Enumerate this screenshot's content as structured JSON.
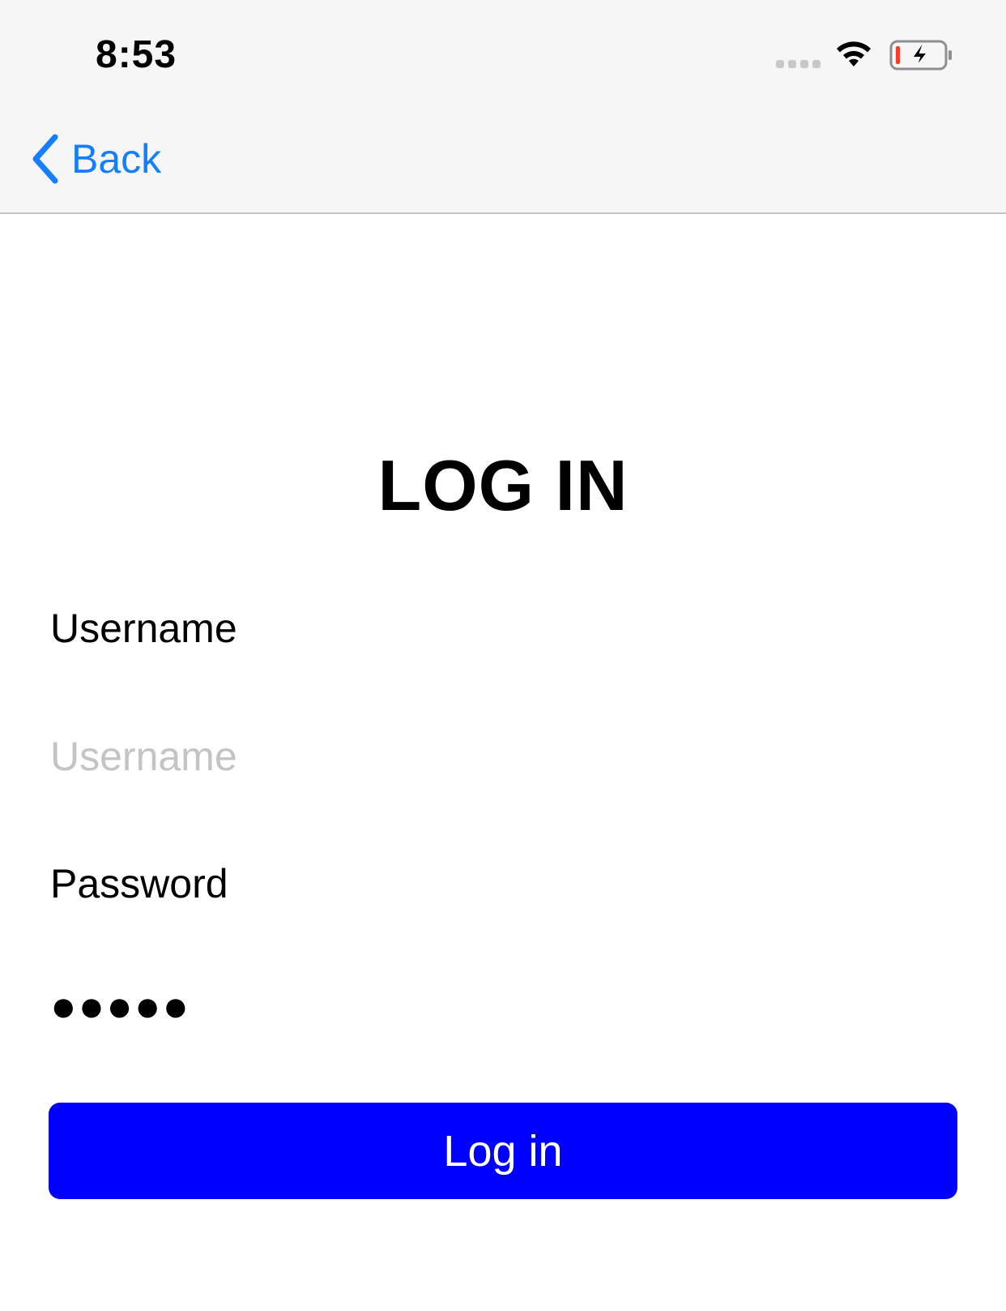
{
  "status_bar": {
    "time": "8:53",
    "icons": [
      "signal-dots-icon",
      "wifi-icon",
      "battery-charging-icon"
    ],
    "battery_level_color": "#ff3b30"
  },
  "nav": {
    "back_label": "Back",
    "back_icon": "chevron-left-icon",
    "accent_color": "#147efb"
  },
  "form": {
    "title": "LOG IN",
    "username_label": "Username",
    "username_value": "",
    "username_placeholder": "Username",
    "password_label": "Password",
    "password_value": "●●●●●",
    "submit_label": "Log in",
    "submit_color": "#0000ff"
  }
}
